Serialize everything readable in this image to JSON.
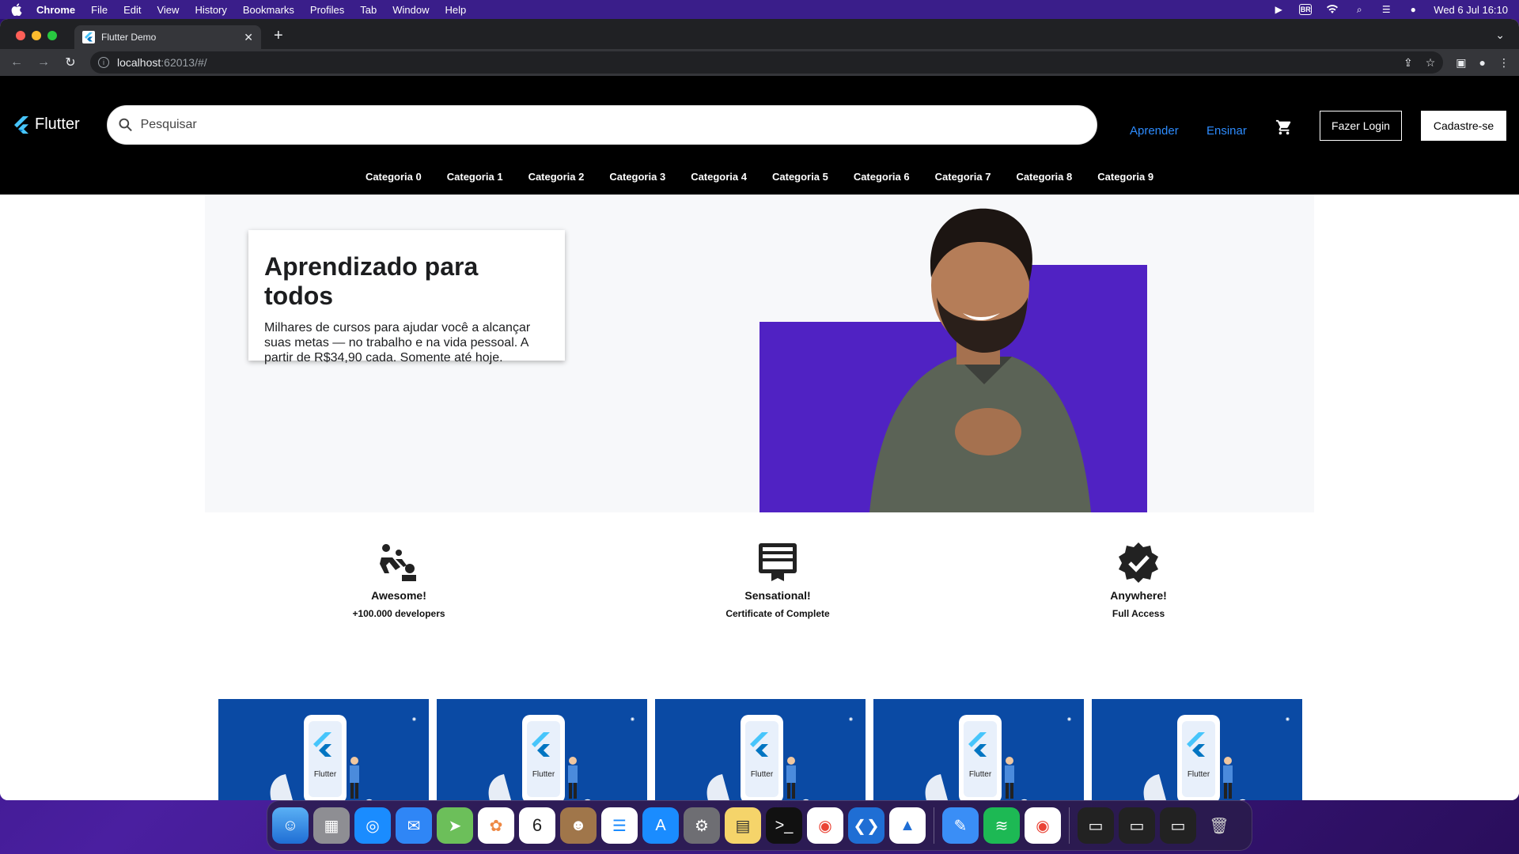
{
  "menubar": {
    "app": "Chrome",
    "items": [
      "File",
      "Edit",
      "View",
      "History",
      "Bookmarks",
      "Profiles",
      "Tab",
      "Window",
      "Help"
    ],
    "input_source": "BR",
    "datetime": "Wed 6 Jul  16:10"
  },
  "browser": {
    "tab_title": "Flutter Demo",
    "url_host": "localhost",
    "url_path": ":62013/#/"
  },
  "app": {
    "logo": "Flutter",
    "search_placeholder": "Pesquisar",
    "links": [
      "Aprender",
      "Ensinar"
    ],
    "login_label": "Fazer Login",
    "signup_label": "Cadastre-se",
    "categories": [
      "Categoria 0",
      "Categoria 1",
      "Categoria 2",
      "Categoria 3",
      "Categoria 4",
      "Categoria 5",
      "Categoria 6",
      "Categoria 7",
      "Categoria 8",
      "Categoria 9"
    ],
    "hero": {
      "title": "Aprendizado para todos",
      "text": "Milhares de cursos para ajudar você a alcançar suas metas — no trabalho e na vida pessoal. A partir de R$34,90 cada. Somente até hoje."
    },
    "features": [
      {
        "title": "Awesome!",
        "subtitle": "+100.000 developers",
        "icon": "group-icon"
      },
      {
        "title": "Sensational!",
        "subtitle": "Certificate of Complete",
        "icon": "certificate-icon"
      },
      {
        "title": "Anywhere!",
        "subtitle": "Full Access",
        "icon": "verified-icon"
      }
    ],
    "course_card_label": "Flutter",
    "accent_color": "#5022c3",
    "course_bg": "#0a4aa4"
  }
}
